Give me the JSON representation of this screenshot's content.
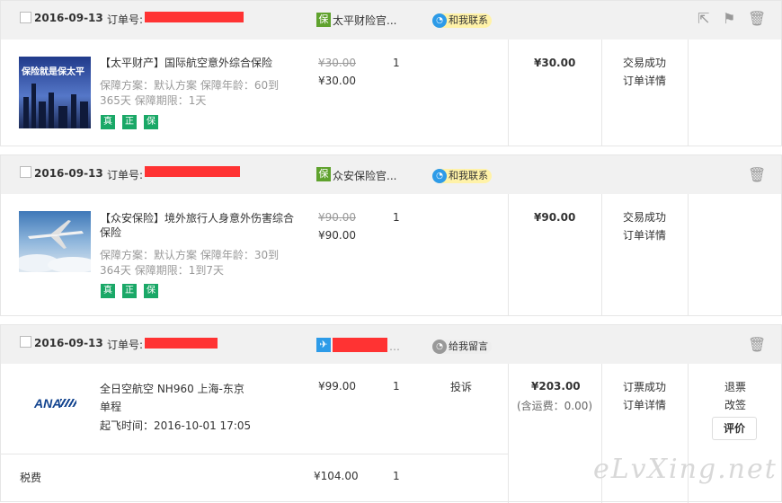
{
  "orders": [
    {
      "date": "2016-09-13",
      "order_label": "订单号:",
      "shop_icon": "保",
      "shop_name": "太平财险官...",
      "contact": "和我联系",
      "product_title": "【太平财产】国际航空意外综合保险",
      "thumb_text": "保险就是保太平",
      "meta_line1": "保障方案：默认方案   保障年龄：60到",
      "meta_line2": "365天   保障期限：1天",
      "orig_price": "¥30.00",
      "price": "¥30.00",
      "qty": "1",
      "total": "¥30.00",
      "status": "交易成功",
      "detail": "订单详情",
      "badges": [
        "真",
        "正",
        "保"
      ]
    },
    {
      "date": "2016-09-13",
      "order_label": "订单号:",
      "shop_icon": "保",
      "shop_name": "众安保险官...",
      "contact": "和我联系",
      "product_title_l1": "【众安保险】境外旅行人身意外伤害综合",
      "product_title_l2": "保险",
      "meta_line1": "保障方案：默认方案   保障年龄：30到",
      "meta_line2": "364天   保障期限：1到7天",
      "orig_price": "¥90.00",
      "price": "¥90.00",
      "qty": "1",
      "total": "¥90.00",
      "status": "交易成功",
      "detail": "订单详情",
      "badges": [
        "真",
        "正",
        "保"
      ]
    },
    {
      "date": "2016-09-13",
      "order_label": "订单号:",
      "contact": "给我留言",
      "airline_logo": "ANA",
      "flight": "全日空航空 NH960 上海-东京",
      "trip_type": "单程",
      "depart_label": "起飞时间：2016-10-01 17:05",
      "price": "¥99.00",
      "qty": "1",
      "complaint": "投诉",
      "total": "¥203.00",
      "shipping": "(含运费：0.00)",
      "status": "订票成功",
      "detail": "订单详情",
      "refund": "退票",
      "change": "改签",
      "review": "评价",
      "tax_label": "税费",
      "tax_price": "¥104.00",
      "tax_qty": "1"
    }
  ],
  "watermark": "eLvXing.net",
  "colors": {
    "redact": "#ff3333",
    "shop_green": "#5fa22d",
    "contact_blue": "#2d9be8",
    "contact_yellow": "#fff2a8",
    "badge_green": "#1aa867"
  }
}
